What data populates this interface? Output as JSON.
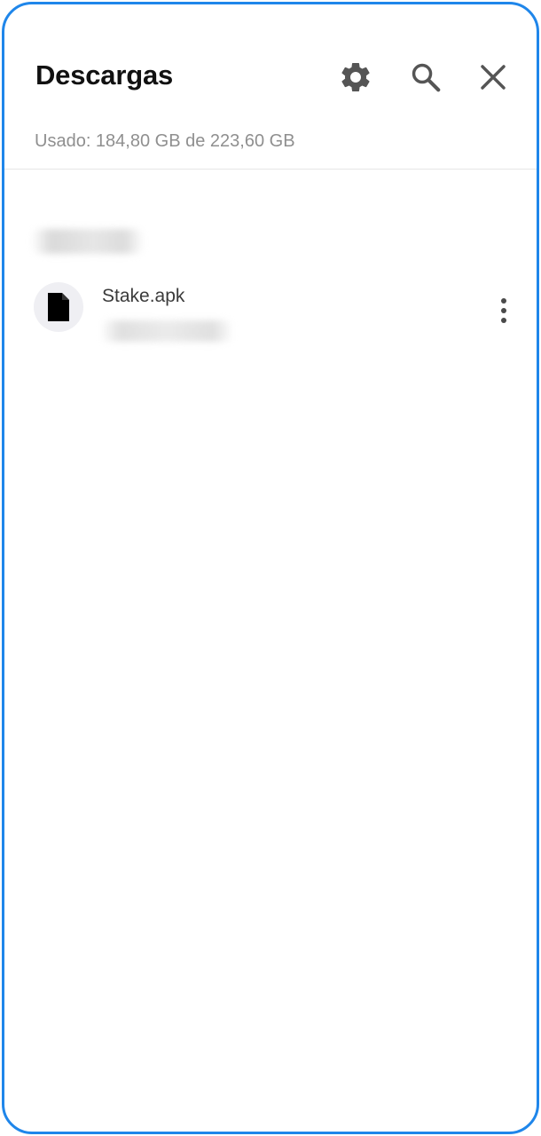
{
  "header": {
    "title": "Descargas",
    "usage": "Usado: 184,80 GB de 223,60 GB",
    "actions": [
      {
        "icon": "gear-icon",
        "label": "settings"
      },
      {
        "icon": "search-icon",
        "label": "search"
      },
      {
        "icon": "close-icon",
        "label": "close"
      }
    ]
  },
  "downloads": {
    "groups": [
      {
        "date_label": "",
        "files": [
          {
            "name": "Stake.apk",
            "meta": "",
            "icon": "file-icon"
          }
        ]
      }
    ]
  },
  "colors": {
    "frame_border": "#1f86ea",
    "title": "#111111",
    "secondary_text": "#8f8f8f",
    "icon_gray": "#555555",
    "file_icon_bg": "#efeff3"
  }
}
